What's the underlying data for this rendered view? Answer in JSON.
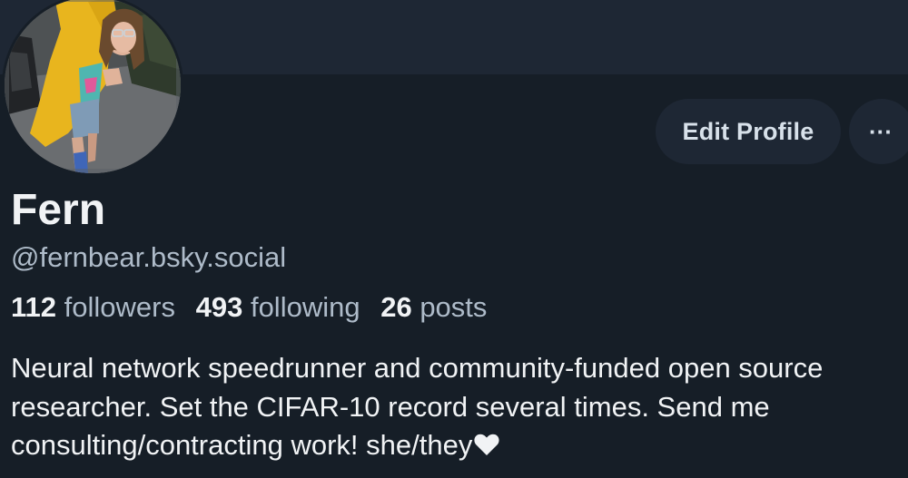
{
  "profile": {
    "display_name": "Fern",
    "handle": "@fernbear.bsky.social",
    "bio": "Neural network speedrunner and community-funded open source researcher. Set the CIFAR-10 record several times. Send me consulting/contracting work! she/they",
    "bio_emoji": "heart-icon"
  },
  "stats": {
    "followers_count": "112",
    "followers_label": "followers",
    "following_count": "493",
    "following_label": "following",
    "posts_count": "26",
    "posts_label": "posts"
  },
  "actions": {
    "edit_profile_label": "Edit Profile",
    "more_label": "···"
  },
  "colors": {
    "background": "#161e27",
    "banner": "#1e2734",
    "button_bg": "#1e2734",
    "text_primary": "#f1f3f5",
    "text_secondary": "#aebbc9"
  }
}
